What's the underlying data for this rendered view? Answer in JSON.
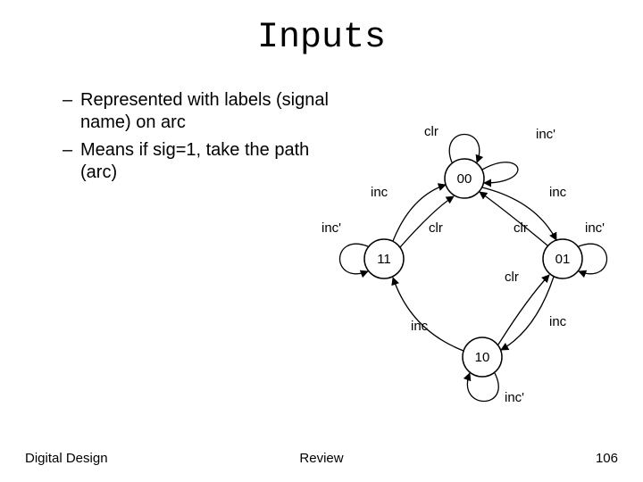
{
  "title": "Inputs",
  "bullets": [
    "Represented with labels (signal name) on arc",
    "Means if sig=1, take the path (arc)"
  ],
  "footer": {
    "left": "Digital Design",
    "center": "Review",
    "right": "106"
  },
  "states": {
    "s00": "00",
    "s01": "01",
    "s10": "10",
    "s11": "11"
  },
  "labels": {
    "clr": "clr",
    "inc": "inc",
    "inc_p": "inc'"
  }
}
